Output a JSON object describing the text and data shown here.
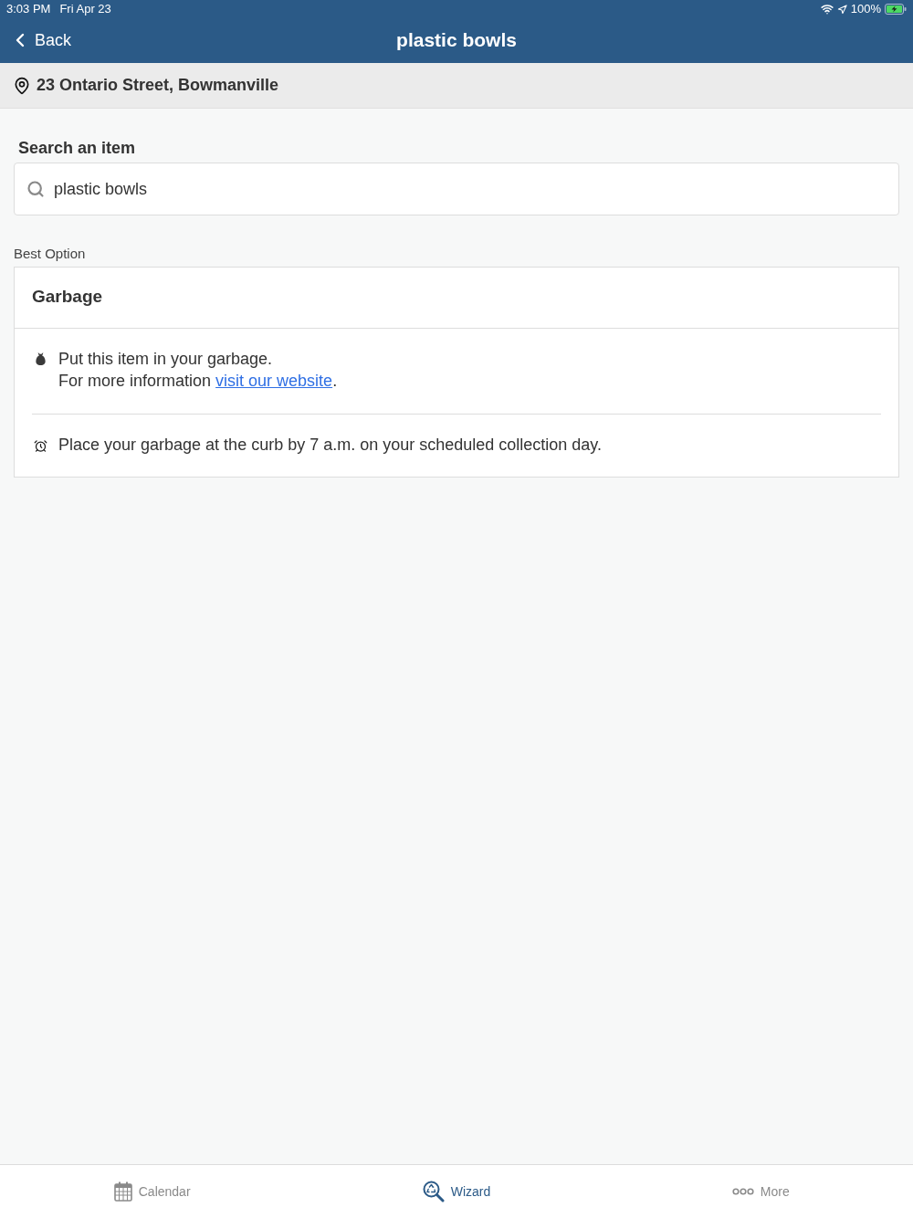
{
  "status_bar": {
    "time": "3:03 PM",
    "date": "Fri Apr 23",
    "battery": "100%",
    "charging": true
  },
  "header": {
    "back": "Back",
    "title": "plastic bowls"
  },
  "address": "23 Ontario Street, Bowmanville",
  "search": {
    "label": "Search an item",
    "value": "plastic bowls"
  },
  "section_label": "Best Option",
  "result": {
    "title": "Garbage",
    "items": [
      {
        "kind": "disposal",
        "line_1": "Put this item in your garbage.",
        "line_2": "For more information",
        "link": "visit our website",
        "after_link": "."
      },
      {
        "kind": "schedule",
        "line_1": "Place your garbage at the curb by 7 a.m. on your scheduled collection day."
      }
    ]
  },
  "tabs": [
    {
      "kind": "calendar",
      "label": "Calendar",
      "selected": false
    },
    {
      "kind": "wizard",
      "label": "Wizard",
      "selected": true
    },
    {
      "kind": "more",
      "label": "More",
      "selected": false
    }
  ]
}
